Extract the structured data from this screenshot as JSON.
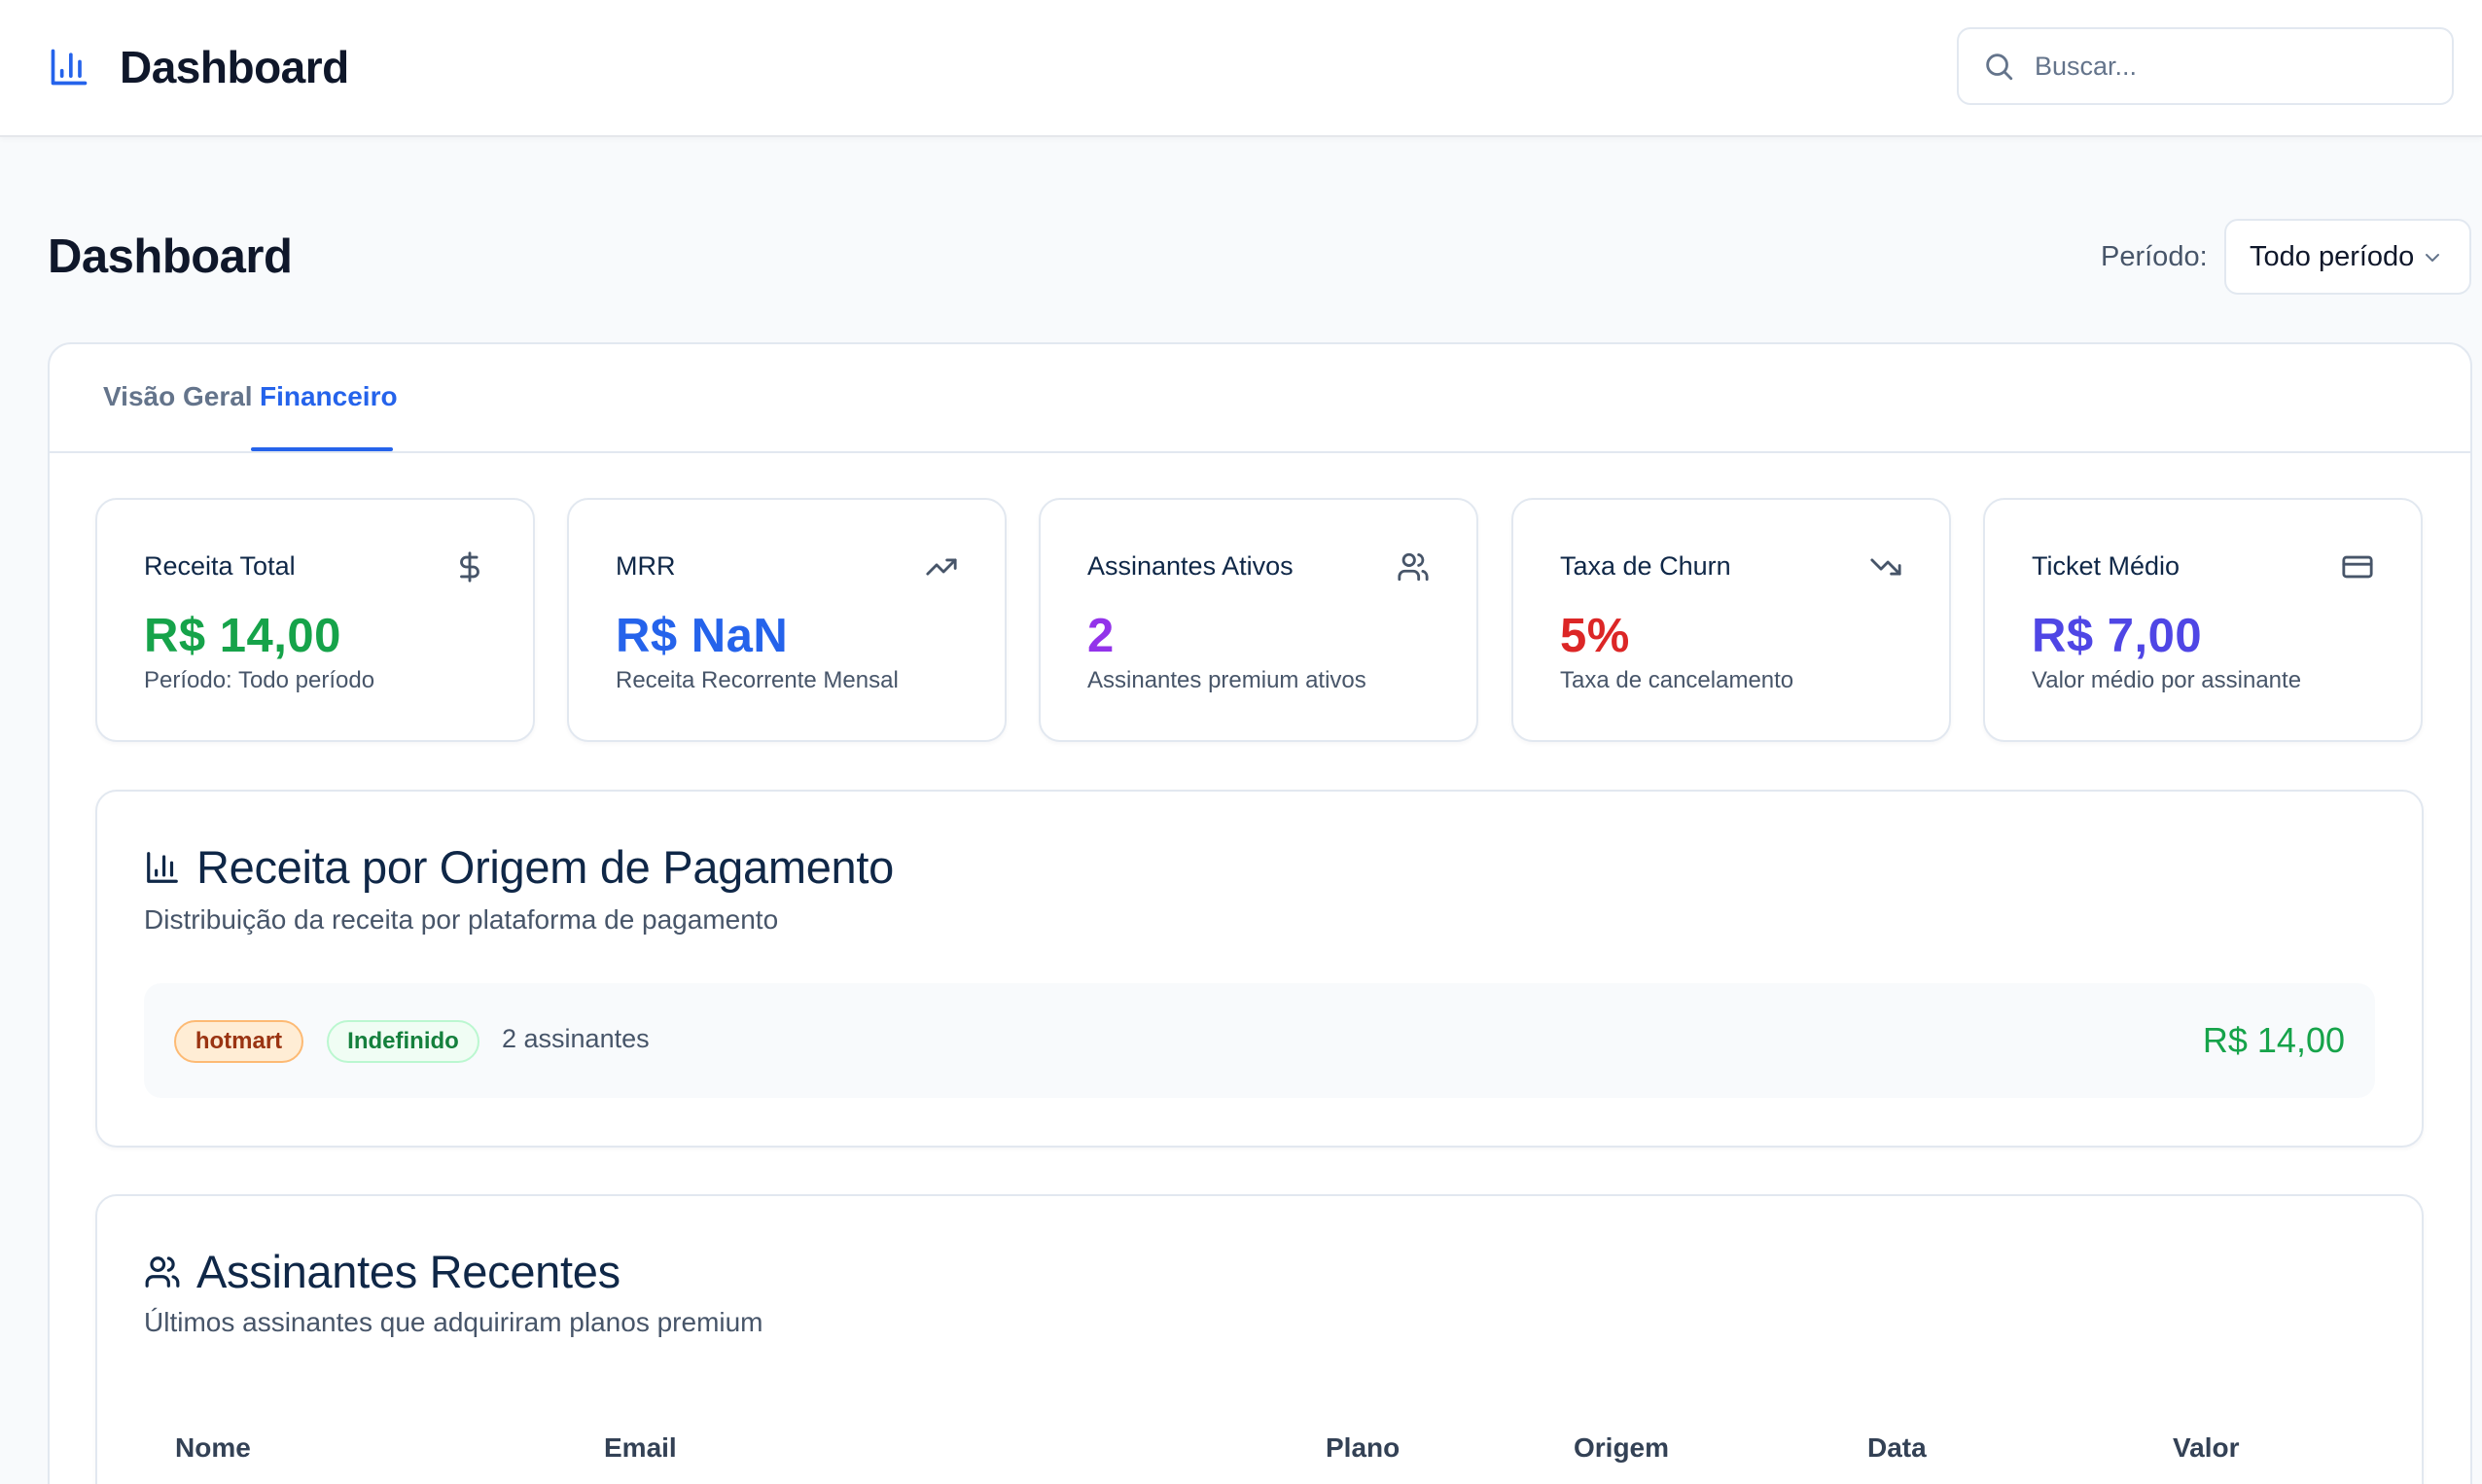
{
  "header": {
    "app_title": "Dashboard",
    "brand_icon": "bar-chart-icon",
    "search": {
      "placeholder": "Buscar...",
      "value": ""
    }
  },
  "page": {
    "title": "Dashboard",
    "period_label": "Período:",
    "period_value": "Todo período"
  },
  "tabs": [
    {
      "label": "Visão Geral",
      "active": false
    },
    {
      "label": "Financeiro",
      "active": true
    }
  ],
  "metrics": [
    {
      "title": "Receita Total",
      "value": "R$ 14,00",
      "subtitle": "Período: Todo período",
      "icon": "dollar-icon",
      "color": "#16a34a"
    },
    {
      "title": "MRR",
      "value": "R$ NaN",
      "subtitle": "Receita Recorrente Mensal",
      "icon": "trending-up-icon",
      "color": "#2563eb"
    },
    {
      "title": "Assinantes Ativos",
      "value": "2",
      "subtitle": "Assinantes premium ativos",
      "icon": "users-icon",
      "color": "#9333ea"
    },
    {
      "title": "Taxa de Churn",
      "value": "5%",
      "subtitle": "Taxa de cancelamento",
      "icon": "trending-down-icon",
      "color": "#dc2626"
    },
    {
      "title": "Ticket Médio",
      "value": "R$ 7,00",
      "subtitle": "Valor médio por assinante",
      "icon": "credit-card-icon",
      "color": "#4f46e5"
    }
  ],
  "revenue_by_origin": {
    "title": "Receita por Origem de Pagamento",
    "description": "Distribuição da receita por plataforma de pagamento",
    "rows": [
      {
        "origin": "hotmart",
        "status": "Indefinido",
        "count": "2 assinantes",
        "value": "R$ 14,00"
      }
    ]
  },
  "recent_subscribers": {
    "title": "Assinantes Recentes",
    "description": "Últimos assinantes que adquiriram planos premium",
    "columns": [
      "Nome",
      "Email",
      "Plano",
      "Origem",
      "Data",
      "Valor"
    ]
  },
  "colors": {
    "accent": "#2563eb",
    "success": "#16a34a",
    "danger": "#dc2626",
    "purple": "#9333ea",
    "indigo": "#4f46e5"
  }
}
